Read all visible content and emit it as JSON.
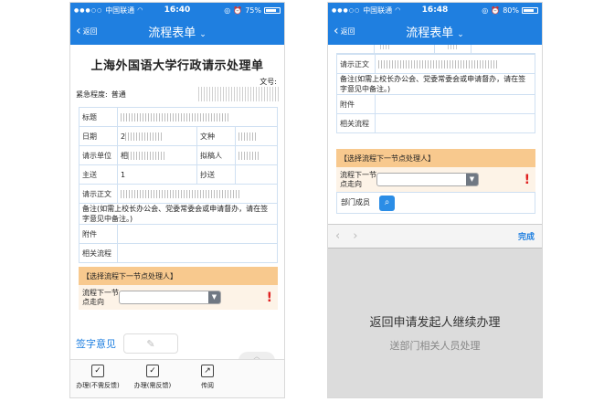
{
  "left": {
    "status": {
      "carrier": "中国联通",
      "time": "16:40",
      "battery": "75%",
      "battery_level": 0.75
    },
    "nav": {
      "back": "返回",
      "title": "流程表单"
    },
    "doc": {
      "title": "上海外国语大学行政请示处理单",
      "wenhao_label": "文号:",
      "urgency_label": "紧急程度:",
      "urgency_value": "普通"
    },
    "form": {
      "title_label": "标题",
      "date_label": "日期",
      "date_value": "2",
      "doctype_label": "文种",
      "unit_label": "请示单位",
      "unit_value": "相",
      "drafter_label": "拟稿人",
      "zhusong_label": "主送",
      "zhusong_value": "1",
      "chaosong_label": "抄送",
      "body_label": "请示正文",
      "remark": "备注(如需上校长办公会、党委常委会或申请督办，请在签字意见中备注。)",
      "attachment_label": "附件",
      "related_label": "相关流程"
    },
    "next": {
      "choose": "【选择流程下一节点处理人】",
      "direction_label": "流程下一节点走向",
      "alert": "!"
    },
    "sign": {
      "label": "签字意见",
      "pen_icon": "pencil-icon"
    },
    "bottom": [
      {
        "label": "办理(不需反馈)",
        "icon": "check-icon"
      },
      {
        "label": "办理(需反馈)",
        "icon": "check-icon"
      },
      {
        "label": "传阅",
        "icon": "share-icon"
      }
    ]
  },
  "right": {
    "status": {
      "carrier": "中国联通",
      "time": "16:48",
      "battery": "80%",
      "battery_level": 0.8
    },
    "nav": {
      "back": "返回",
      "title": "流程表单"
    },
    "form": {
      "body_label": "请示正文",
      "remark": "备注(如需上校长办公会、党委常委会或申请督办，请在签字意见中备注。)",
      "attachment_label": "附件",
      "related_label": "相关流程"
    },
    "next": {
      "choose": "【选择流程下一节点处理人】",
      "direction_label": "流程下一节点走向",
      "alert": "!",
      "member_label": "部门成员"
    },
    "toolbar": {
      "done": "完成"
    },
    "sheet": {
      "main": "返回申请发起人继续办理",
      "sub": "送部门相关人员处理"
    }
  }
}
